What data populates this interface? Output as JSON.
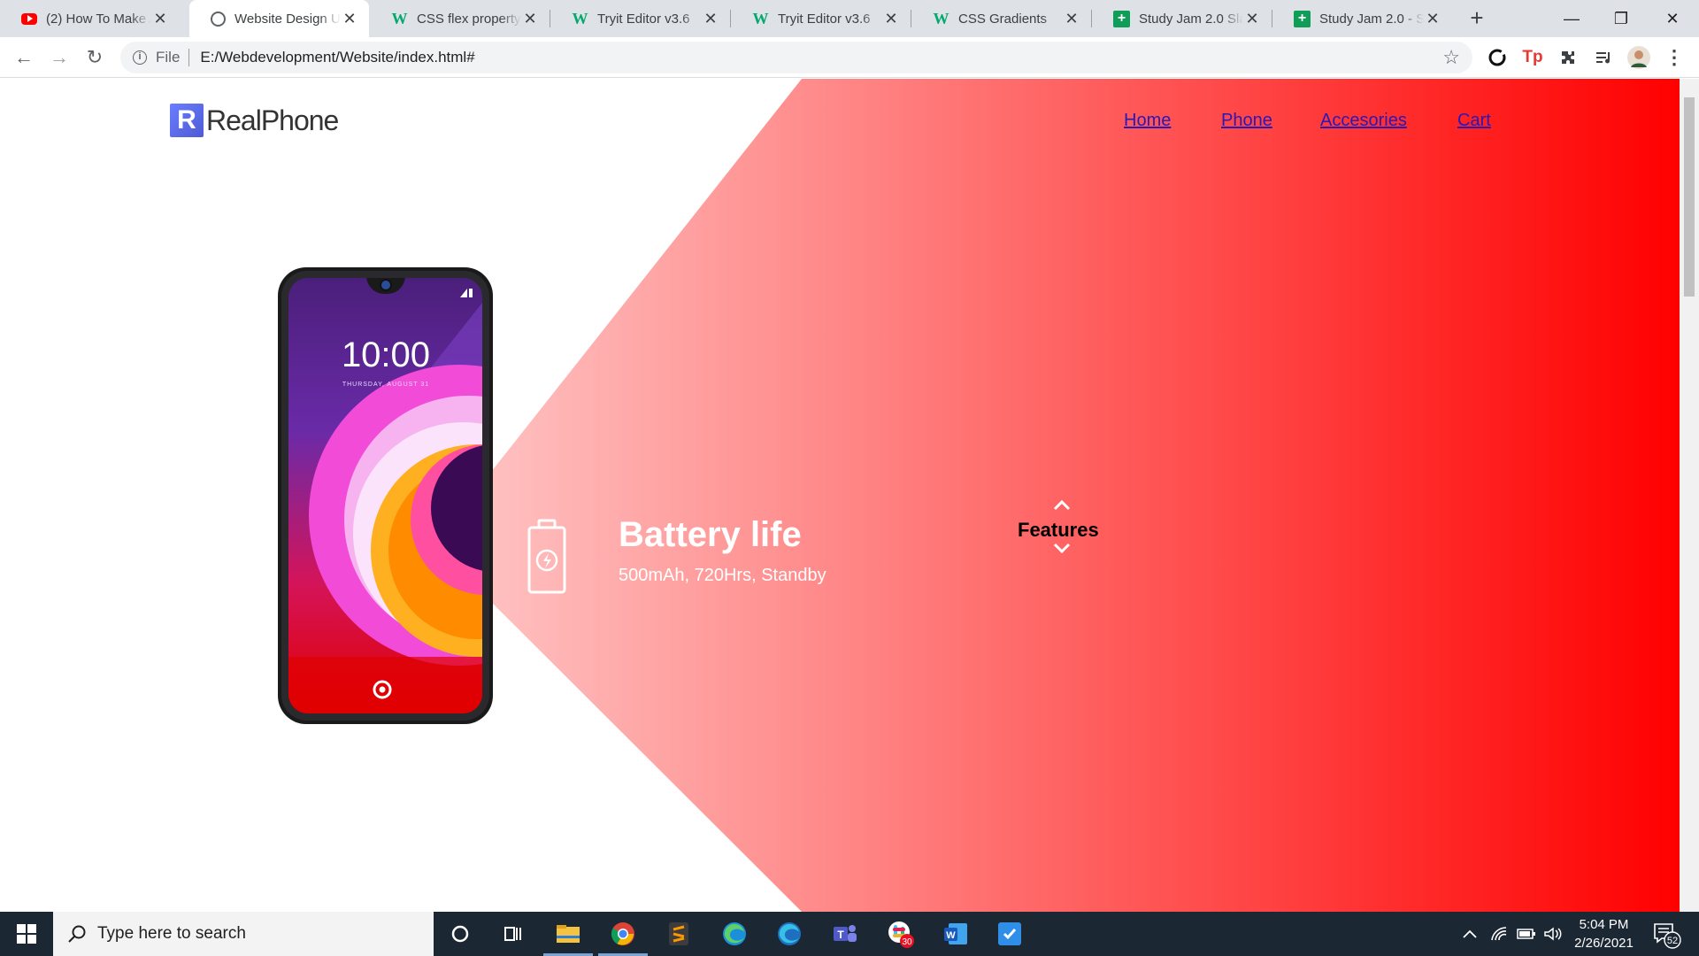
{
  "browser": {
    "tabs": [
      {
        "title": "(2) How To Make A",
        "icon": "youtube-icon"
      },
      {
        "title": "Website Design Us",
        "icon": "globe-icon"
      },
      {
        "title": "CSS flex property",
        "icon": "w3schools-icon"
      },
      {
        "title": "Tryit Editor v3.6",
        "icon": "w3schools-icon"
      },
      {
        "title": "Tryit Editor v3.6",
        "icon": "w3schools-icon"
      },
      {
        "title": "CSS Gradients",
        "icon": "w3schools-icon"
      },
      {
        "title": "Study Jam 2.0 Slack",
        "icon": "google-sheets-icon"
      },
      {
        "title": "Study Jam 2.0 - Sla",
        "icon": "google-sheets-icon"
      }
    ],
    "active_tab": 1,
    "address": {
      "scheme_label": "File",
      "url": "E:/Webdevelopment/Website/index.html#"
    }
  },
  "site": {
    "logo_letter": "R",
    "brand": "RealPhone",
    "nav": [
      {
        "label": "Home"
      },
      {
        "label": "Phone"
      },
      {
        "label": "Accesories"
      },
      {
        "label": "Cart"
      }
    ],
    "phone_screen": {
      "time": "10:00",
      "date": "THURSDAY, AUGUST 31"
    },
    "feature": {
      "title": "Battery life",
      "subtitle": "500mAh, 720Hrs, Standby"
    },
    "features_label": "Features",
    "colors": {
      "accent_red": "#ff0000",
      "link": "#2a18b8",
      "logo": "#5b6cf0"
    }
  },
  "taskbar": {
    "search_placeholder": "Type here to search",
    "slack_badge": "30",
    "time": "5:04 PM",
    "date": "2/26/2021",
    "notification_count": "52"
  }
}
